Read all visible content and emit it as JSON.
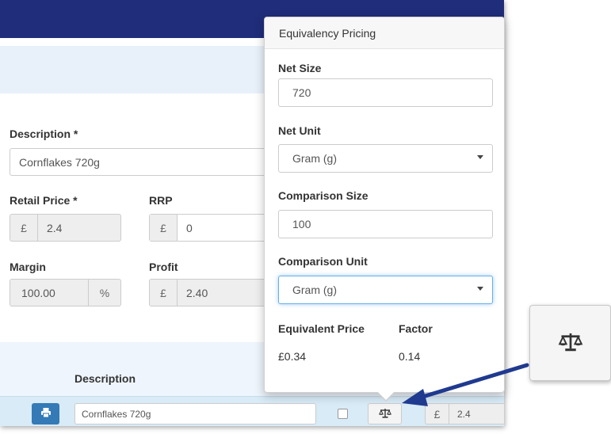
{
  "form": {
    "description_label": "Description *",
    "description_value": "Cornflakes 720g",
    "retail_price_label": "Retail Price *",
    "retail_price_currency": "£",
    "retail_price_value": "2.4",
    "rrp_label": "RRP",
    "rrp_currency": "£",
    "rrp_value": "0",
    "margin_label": "Margin",
    "margin_value": "100.00",
    "margin_unit": "%",
    "profit_label": "Profit",
    "profit_currency": "£",
    "profit_value": "2.40"
  },
  "table": {
    "description_header": "Description",
    "row": {
      "description_value": "Cornflakes 720g",
      "price_currency": "£",
      "price_value": "2.4"
    }
  },
  "popover": {
    "title": "Equivalency Pricing",
    "net_size_label": "Net Size",
    "net_size_value": "720",
    "net_unit_label": "Net Unit",
    "net_unit_value": "Gram (g)",
    "comparison_size_label": "Comparison Size",
    "comparison_size_value": "100",
    "comparison_unit_label": "Comparison Unit",
    "comparison_unit_value": "Gram (g)",
    "equivalent_price_label": "Equivalent Price",
    "equivalent_price_value": "£0.34",
    "factor_label": "Factor",
    "factor_value": "0.14"
  },
  "icons": {
    "print": "print-icon",
    "scale": "balance-scale-icon",
    "dropdown": "chevron-down-icon"
  },
  "colors": {
    "topbar": "#1f2d7a",
    "primary_button": "#337ab7",
    "arrow": "#1f3a8f",
    "focus_border": "#66afe9"
  }
}
